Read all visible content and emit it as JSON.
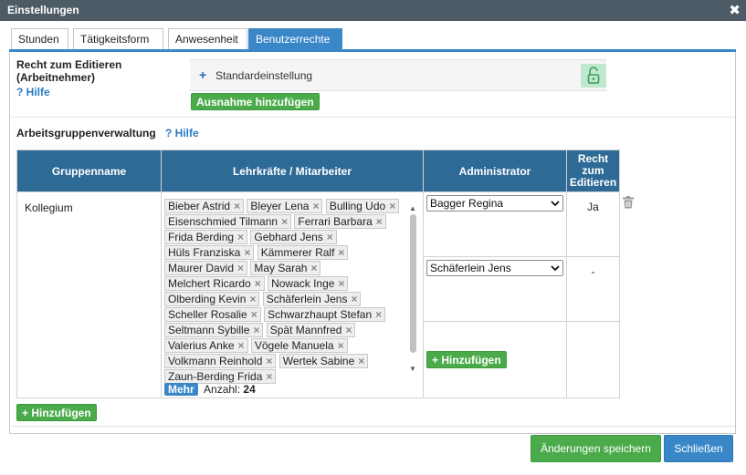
{
  "window": {
    "title": "Einstellungen",
    "close_glyph": "✖"
  },
  "tabs": [
    {
      "label": "Stunden"
    },
    {
      "label": "Tätigkeitsform"
    },
    {
      "label": "Anwesenheit"
    },
    {
      "label": "Benutzerrechte",
      "active": true
    }
  ],
  "edit_right": {
    "label_line1": "Recht zum Editieren",
    "label_line2": "(Arbeitnehmer)",
    "help": "? Hilfe",
    "standard_plus": "+",
    "standard_label": "Standardeinstellung",
    "lock_icon": "unlock-icon",
    "add_exception_button": "Ausnahme hinzufügen"
  },
  "group_admin": {
    "label": "Arbeitsgruppenverwaltung",
    "help": "? Hilfe",
    "columns": {
      "group_name": "Gruppenname",
      "staff": "Lehrkräfte / Mitarbeiter",
      "admin": "Administrator",
      "right_line1": "Recht",
      "right_line2": "zum",
      "right_line3": "Editieren"
    },
    "rows": [
      {
        "group_name": "Kollegium",
        "staff": [
          "Bieber Astrid",
          "Bleyer Lena",
          "Bulling Udo",
          "Eisenschmied Tilmann",
          "Ferrari Barbara",
          "Frida Berding",
          "Gebhard Jens",
          "Hüls Franziska",
          "Kämmerer Ralf",
          "Maurer David",
          "May Sarah",
          "Melchert Ricardo",
          "Nowack Inge",
          "Olberding Kevin",
          "Schäferlein Jens",
          "Scheller Rosalie",
          "Schwarzhaupt Stefan",
          "Seltmann Sybille",
          "Spät Mannfred",
          "Valerius Anke",
          "Vögele Manuela",
          "Volkmann Reinhold",
          "Wertek Sabine",
          "Zaun-Berding Frida"
        ],
        "more_button": "Mehr",
        "count_label": "Anzahl:",
        "count_value": "24",
        "admins": [
          {
            "name": "Bagger Regina",
            "right": "Ja"
          },
          {
            "name": "Schäferlein Jens",
            "right": "-"
          }
        ],
        "add_admin_button": "+ Hinzufügen"
      }
    ],
    "add_group_button": "+ Hinzufügen"
  },
  "footer": {
    "save_button": "Änderungen speichern",
    "close_button": "Schließen"
  },
  "colors": {
    "titlebar": "#4d5b66",
    "accent_blue": "#3a87c8",
    "table_header": "#2e6a96",
    "green": "#4bab4b"
  }
}
